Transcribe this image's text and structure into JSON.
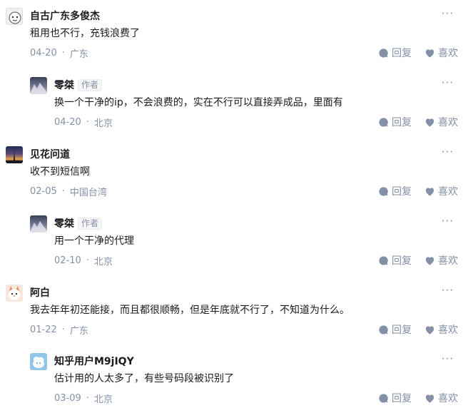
{
  "actions": {
    "reply": "回复",
    "like": "喜欢"
  },
  "more_glyph": "···",
  "comments": [
    {
      "author": "自古广东多俊杰",
      "text": "租用也不行，充钱浪费了",
      "date": "04-20",
      "location": "广东",
      "is_reply": false,
      "author_tag": ""
    },
    {
      "author": "零桀",
      "text": "换一个干净的ip，不会浪费的，实在不行可以直接弄成品，里面有",
      "date": "04-20",
      "location": "北京",
      "is_reply": true,
      "author_tag": "作者"
    },
    {
      "author": "见花问道",
      "text": "收不到短信啊",
      "date": "02-05",
      "location": "中国台湾",
      "is_reply": false,
      "author_tag": ""
    },
    {
      "author": "零桀",
      "text": "用一个干净的代理",
      "date": "02-10",
      "location": "北京",
      "is_reply": true,
      "author_tag": "作者"
    },
    {
      "author": "阿白",
      "text": "我去年年初还能接，而且都很顺畅，但是年底就不行了，不知道为什么。",
      "date": "01-22",
      "location": "广东",
      "is_reply": false,
      "author_tag": ""
    },
    {
      "author": "知乎用户M9jIQY",
      "text": "估计用的人太多了，有些号码段被识别了",
      "date": "03-09",
      "location": "北京",
      "is_reply": true,
      "author_tag": ""
    }
  ],
  "colors": {
    "meta": "#8590a6",
    "text": "#191b1f"
  }
}
